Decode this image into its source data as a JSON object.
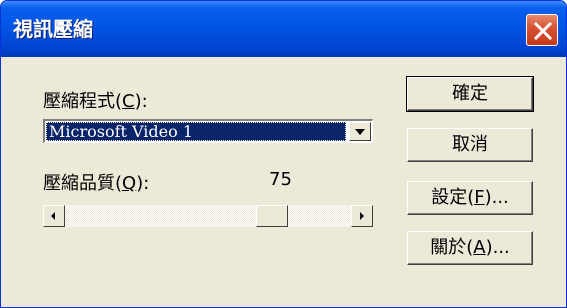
{
  "window": {
    "title": "視訊壓縮"
  },
  "compressor": {
    "label_prefix": "壓縮程式(",
    "mnemonic": "C",
    "label_suffix": "):",
    "selected": "Microsoft Video 1"
  },
  "quality": {
    "label_prefix": "壓縮品質(",
    "mnemonic": "Q",
    "label_suffix": "):",
    "value": "75",
    "level_percent": 75
  },
  "buttons": {
    "ok": "確定",
    "cancel": "取消",
    "configure_prefix": "設定(",
    "configure_mnemonic": "F",
    "configure_suffix": ")...",
    "about_prefix": "關於(",
    "about_mnemonic": "A",
    "about_suffix": ")..."
  },
  "colors": {
    "titlebar": "#0055E5",
    "close": "#D6502F",
    "selection": "#0A246A",
    "face": "#ECE9D8"
  },
  "icons": {
    "close": "close-icon",
    "dropdown": "chevron-down-icon",
    "scroll_left": "arrow-left-icon",
    "scroll_right": "arrow-right-icon"
  }
}
